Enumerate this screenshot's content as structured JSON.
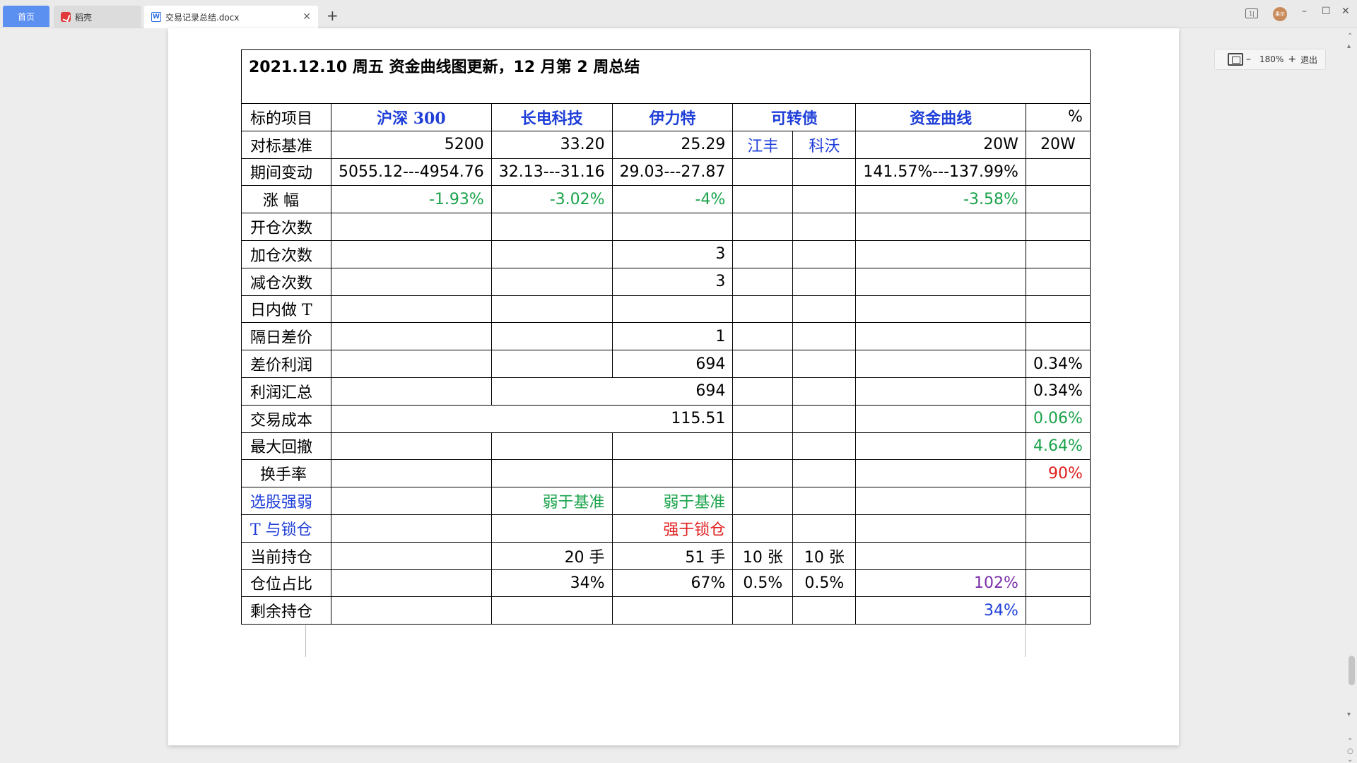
{
  "tabs": {
    "home": "首页",
    "daoke": "稻壳",
    "doc": "交易记录总结.docx",
    "add": "+"
  },
  "window": {
    "reader_icon_text": "1|",
    "avatar_text": "果尔",
    "minimize": "–",
    "maximize": "☐",
    "close": "✕"
  },
  "zoom": {
    "minus": "–",
    "value": "180%",
    "plus": "+",
    "exit": "退出"
  },
  "doc": {
    "title": "2021.12.10  周五  资金曲线图更新，12 月第 2 周总结",
    "headers": [
      "标的项目",
      "沪深 300",
      "长电科技",
      "伊力特",
      "可转债",
      "资金曲线",
      "%"
    ],
    "rows": {
      "benchmark": {
        "label": "对标基准",
        "hs300": "5200",
        "cdkj": "33.20",
        "ylt": "25.29",
        "jf": "江丰",
        "kw": "科沃",
        "curve": "20W",
        "pct": "20W"
      },
      "change": {
        "label": "期间变动",
        "hs300": "5055.12---4954.76",
        "cdkj": "32.13---31.16",
        "ylt": "29.03---27.87",
        "curve": "141.57%---137.99%"
      },
      "rise": {
        "label": "涨  幅",
        "hs300": "-1.93%",
        "cdkj": "-3.02%",
        "ylt": "-4%",
        "curve": "-3.58%"
      },
      "open_count": {
        "label": "开仓次数"
      },
      "add_count": {
        "label": "加仓次数",
        "ylt": "3"
      },
      "reduce_count": {
        "label": "减仓次数",
        "ylt": "3"
      },
      "intraday_t": {
        "label": "日内做 T"
      },
      "overnight_spread": {
        "label": "隔日差价",
        "ylt": "1"
      },
      "spread_profit": {
        "label": "差价利润",
        "ylt": "694",
        "pct": "0.34%"
      },
      "profit_total": {
        "label": "利润汇总",
        "ylt": "694",
        "pct": "0.34%"
      },
      "trade_cost": {
        "label": "交易成本",
        "ylt": "115.51",
        "pct": "0.06%"
      },
      "max_drawdown": {
        "label": "最大回撤",
        "pct": "4.64%"
      },
      "turnover": {
        "label": "换手率",
        "pct": "90%"
      },
      "stock_strength": {
        "label": "选股强弱",
        "cdkj": "弱于基准",
        "ylt": "弱于基准"
      },
      "t_lock": {
        "label": "T 与锁仓",
        "ylt": "强于锁仓"
      },
      "current_hold": {
        "label": "当前持仓",
        "cdkj": "20 手",
        "ylt": "51 手",
        "jf": "10 张",
        "kw": "10 张"
      },
      "position_ratio": {
        "label": "仓位占比",
        "cdkj": "34%",
        "ylt": "67%",
        "jf": "0.5%",
        "kw": "0.5%",
        "curve": "102%"
      },
      "remaining": {
        "label": "剩余持仓",
        "curve": "34%"
      }
    }
  },
  "colors": {
    "header_blue": "#1f3fd8",
    "positive_green": "#1aa34a",
    "alert_red": "#e01e1e",
    "purple": "#7a2fa8",
    "home_tab": "#5b8ff0"
  }
}
